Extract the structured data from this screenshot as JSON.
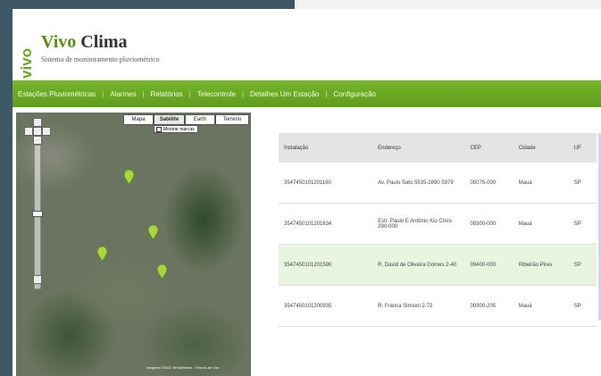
{
  "brand": {
    "name": "Vivo",
    "product": "Clima",
    "subtitle": "Sistema de monitoramento pluviométrico",
    "logo_text": "vivo",
    "accent": "#6aa825"
  },
  "nav": {
    "items": [
      "Estações Pluviométricas",
      "Alarmes",
      "Relatórios",
      "Telecontrole",
      "Detalhes Um Estação",
      "Configuração"
    ]
  },
  "map": {
    "types": [
      "Mapa",
      "Satélite",
      "Earth",
      "Terreno"
    ],
    "active_type": "Satélite",
    "labels_checkbox": "Mostrar marcas",
    "attribution": "Imagens ©2011 TerraMetrics - Termos de Uso"
  },
  "table": {
    "headers": [
      "Instalação",
      "Endereço",
      "CEP",
      "Cidade",
      "UF"
    ],
    "rows": [
      [
        "3547450101201160",
        "Av. Paulo Sato 5535-2890 5979",
        "05075-000",
        "Mauá",
        "SP"
      ],
      [
        "3547450101201634",
        "Estr. Paulo E Antônio Kio Chiro 290-000",
        "09300-000",
        "Mauá",
        "SP"
      ],
      [
        "3547450101201590",
        "R. David de Oliveira Gomes 2-40",
        "09400-000",
        "Ribeirão Pires",
        "SP"
      ],
      [
        "3547450101200935",
        "R. Franca Simioni 2-72",
        "09300-205",
        "Mauá",
        "SP"
      ]
    ]
  }
}
